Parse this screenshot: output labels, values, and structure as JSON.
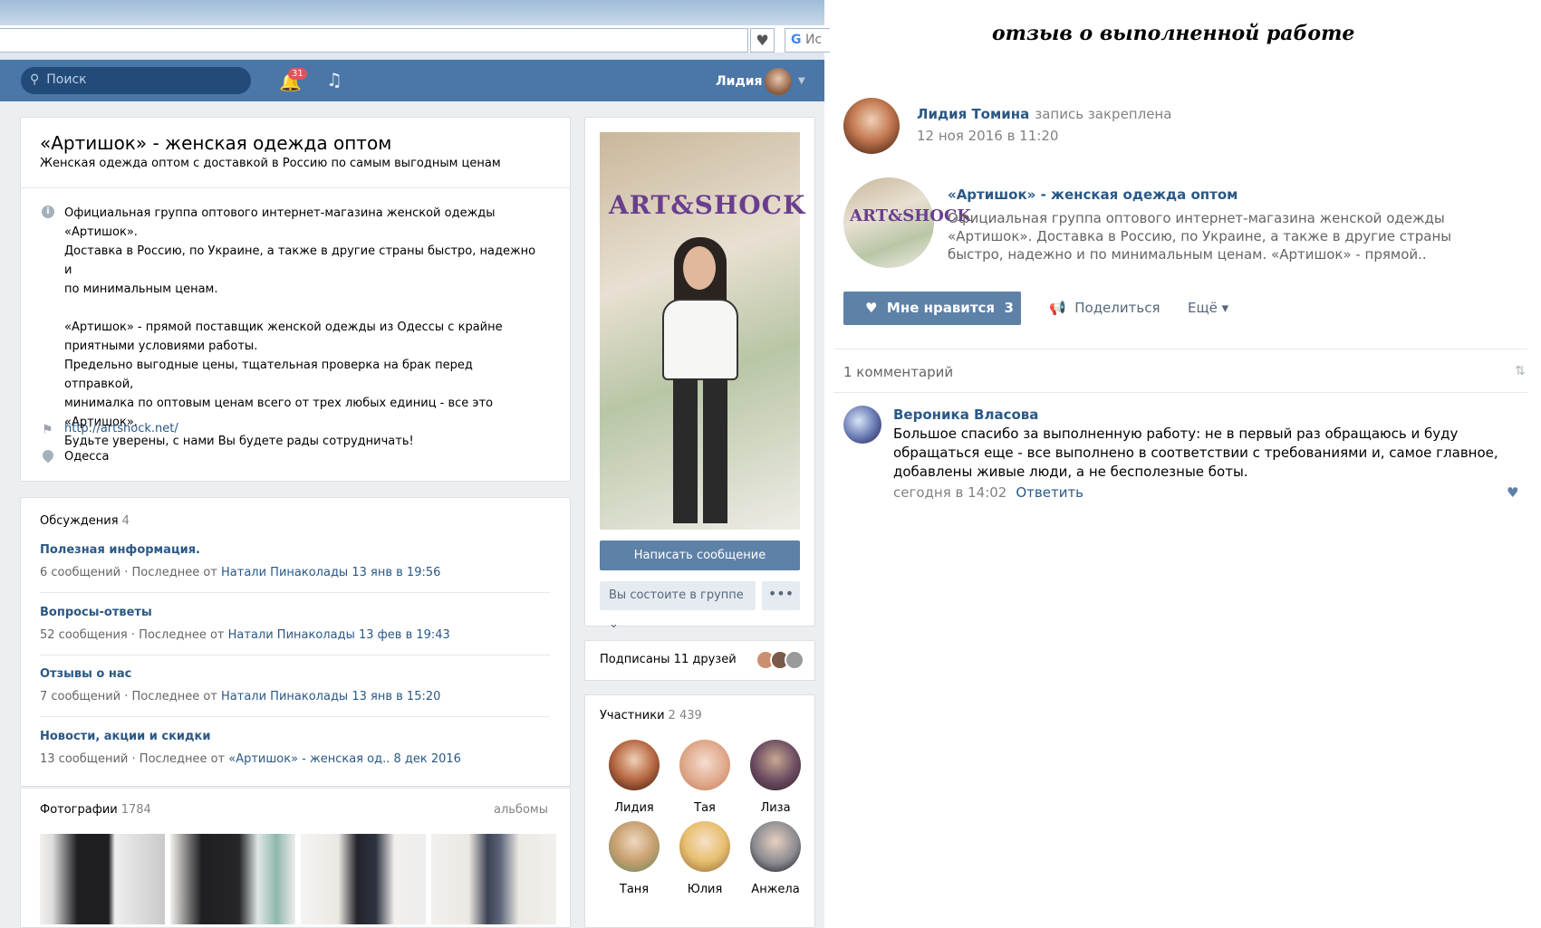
{
  "browser": {
    "search_hint": "Ис"
  },
  "header": {
    "search_placeholder": "Поиск",
    "notifications": "31",
    "user_name": "Лидия"
  },
  "group": {
    "title": "«Артишок» - женская одежда оптом",
    "subtitle": "Женская одежда оптом с доставкой в Россию по самым выгодным ценам",
    "description": "Официальная группа оптового интернет-магазина женской одежды\n«Артишок».\nДоставка в Россию, по Украине, а также в другие страны быстро, надежно и\nпо минимальным ценам.\n\n«Артишок» - прямой поставщик женской одежды из Одессы с крайне\nприятными условиями работы.\nПредельно выгодные цены, тщательная проверка на брак перед отправкой,\nминималка по оптовым ценам всего от трех любых единиц - все это\n«Артишок».\nБудьте уверены, с нами Вы будете рады сотрудничать!",
    "site": "http://artshock.net/",
    "city": "Одесса",
    "logo_text": "ART&SHOCK"
  },
  "discussions": {
    "title": "Обсуждения",
    "count": "4",
    "topics": [
      {
        "title": "Полезная информация.",
        "count": "6 сообщений",
        "last_prefix": "Последнее от",
        "author": "Натали Пинаколады",
        "date": "13 янв в 19:56"
      },
      {
        "title": "Вопросы-ответы",
        "count": "52 сообщения",
        "last_prefix": "Последнее от",
        "author": "Натали Пинаколады",
        "date": "13 фев в 19:43"
      },
      {
        "title": "Отзывы о нас",
        "count": "7 сообщений",
        "last_prefix": "Последнее от",
        "author": "Натали Пинаколады",
        "date": "13 янв в 15:20"
      },
      {
        "title": "Новости, акции и скидки",
        "count": "13 сообщений",
        "last_prefix": "Последнее от",
        "author": "«Артишок» - женская од..",
        "date": "8 дек 2016"
      }
    ]
  },
  "photos": {
    "title": "Фотографии",
    "count": "1784",
    "albums_link": "альбомы"
  },
  "side": {
    "message_button": "Написать сообщение",
    "member_button": "Вы состоите в группе",
    "more_button": "•••",
    "friends_text": "Подписаны 11 друзей",
    "members_title": "Участники",
    "members_count": "2 439",
    "members": [
      "Лидия",
      "Тая",
      "Лиза",
      "Таня",
      "Юлия",
      "Анжела"
    ]
  },
  "review": {
    "heading": "отзыв о выполненной работе",
    "author": "Лидия Томина",
    "pinned": "запись закреплена",
    "date": "12 ноя 2016 в 11:20",
    "repost_title": "«Артишок» - женская одежда оптом",
    "repost_text": "Официальная группа оптового интернет-магазина женской одежды «Артишок». Доставка в Россию, по Украине, а также в другие страны быстро, надежно и по минимальным ценам. «Артишок» - прямой..",
    "like_label": "Мне нравится",
    "like_count": "3",
    "share_label": "Поделиться",
    "more_label": "Ещё",
    "comments_count": "1 комментарий",
    "comment": {
      "author": "Вероника Власова",
      "text": "Большое спасибо за выполненную работу: не в первый раз обращаюсь и буду обращаться еще - все выполнено в соответствии с требованиями и, самое главное, добавлены живые люди, а не бесполезные боты.",
      "time": "сегодня в 14:02",
      "reply": "Ответить"
    }
  },
  "colors": {
    "vk_blue": "#4a76a8",
    "link": "#2a5885",
    "button": "#5e81a8",
    "page_bg": "#edeef0"
  }
}
